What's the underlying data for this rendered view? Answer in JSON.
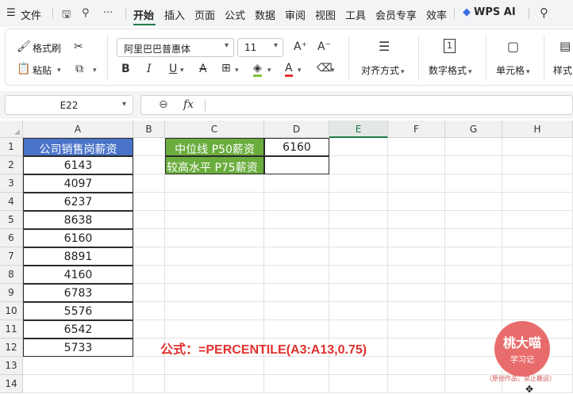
{
  "menubar": {
    "menu_icon": "hamburger-icon",
    "file": "文件",
    "tabs": [
      "开始",
      "插入",
      "页面",
      "公式",
      "数据",
      "审阅",
      "视图",
      "工具",
      "会员专享",
      "效率"
    ],
    "active_tab": "开始",
    "more": "···",
    "wps_ai": "WPS AI"
  },
  "ribbon": {
    "format_painter": "格式刷",
    "paste": "粘贴",
    "font_name": "阿里巴巴普惠体",
    "font_size": "11",
    "bold": "B",
    "italic": "I",
    "underline": "U",
    "strike": "A",
    "font_color": "A",
    "align_label": "对齐方式",
    "number_label": "数字格式",
    "cell_label": "单元格",
    "style_label": "样式",
    "number_icon_text": "1"
  },
  "formula_bar": {
    "name_box": "E22",
    "fx": "fx",
    "formula": ""
  },
  "grid": {
    "columns": [
      "A",
      "B",
      "C",
      "D",
      "E",
      "F",
      "G",
      "H"
    ],
    "selected_column": "E",
    "rows": [
      "1",
      "2",
      "3",
      "4",
      "5",
      "6",
      "7",
      "8",
      "9",
      "10",
      "11",
      "12",
      "13",
      "14"
    ],
    "a_header": "公司销售岗薪资",
    "a_values": [
      "6143",
      "4097",
      "6237",
      "8638",
      "6160",
      "8891",
      "4160",
      "6783",
      "5576",
      "6542",
      "5733"
    ],
    "c1": "中位线 P50薪资",
    "d1": "6160",
    "c2": "较高水平 P75薪资",
    "d2": ""
  },
  "annotation": {
    "formula_note": "公式：=PERCENTILE(A3:A13,0.75)"
  },
  "watermark": {
    "line1": "桃大喵",
    "line2": "学习记",
    "note": "（原创作品，禁止搬运）"
  },
  "colors": {
    "header_blue": "#4a74c9",
    "header_green": "#6aad3d",
    "accent_green": "#1e7b45",
    "formula_red": "#e0312c"
  }
}
